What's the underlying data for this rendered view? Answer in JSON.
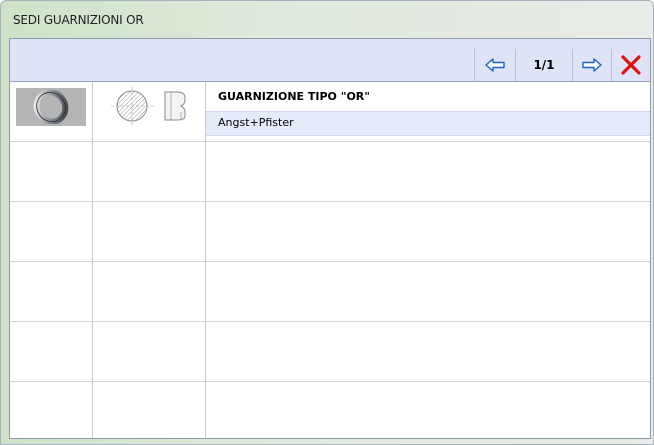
{
  "window": {
    "title": "SEDI GUARNIZIONI OR"
  },
  "toolbar": {
    "prev_icon": "arrow-left-icon",
    "page_indicator": "1/1",
    "next_icon": "arrow-right-icon",
    "close_icon": "close-icon",
    "arrow_color": "#1a64c8",
    "close_color": "#e01010"
  },
  "records": [
    {
      "image_icon": "o-ring-icon",
      "drawing_icon": "o-ring-section-drawing-icon",
      "name": "GUARNIZIONE TIPO \"OR\"",
      "manufacturer": "Angst+Pfister"
    }
  ],
  "empty_rows": 5
}
